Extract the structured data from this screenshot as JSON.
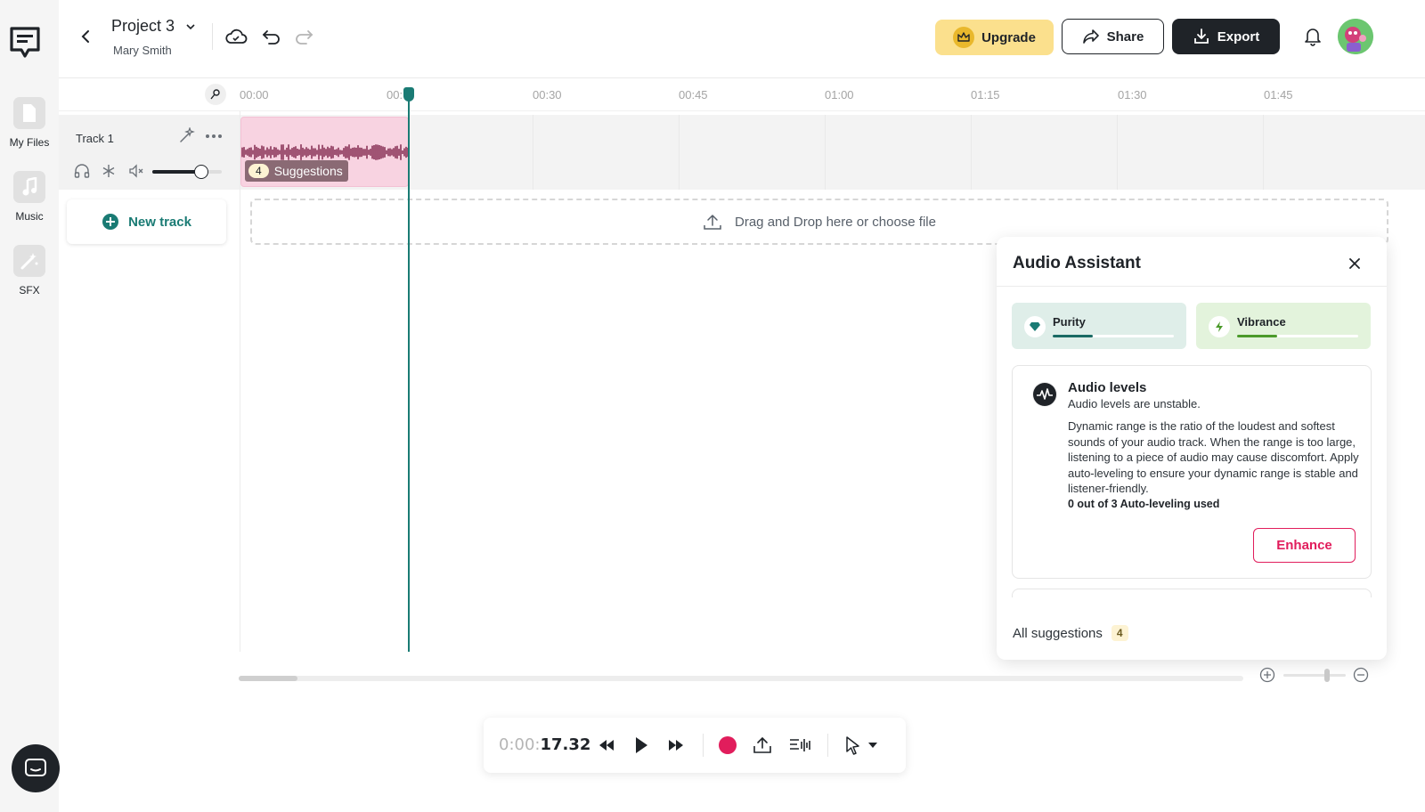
{
  "sidebar": {
    "items": [
      {
        "label": "My Files",
        "icon": "file-icon"
      },
      {
        "label": "Music",
        "icon": "music-note-icon"
      },
      {
        "label": "SFX",
        "icon": "magic-wand-icon"
      }
    ]
  },
  "header": {
    "project_name": "Project 3",
    "owner": "Mary Smith",
    "upgrade_label": "Upgrade",
    "share_label": "Share",
    "export_label": "Export"
  },
  "timeline": {
    "ticks": [
      "00:00",
      "00:",
      "00:30",
      "00:45",
      "01:00",
      "01:15",
      "01:30",
      "01:45"
    ]
  },
  "track": {
    "name": "Track 1",
    "volume": 0.7,
    "clip": {
      "suggestions_count": "4",
      "suggestions_label": "Suggestions"
    }
  },
  "new_track_label": "New track",
  "dropzone_label": "Drag and Drop here or choose file",
  "assistant": {
    "title": "Audio Assistant",
    "metrics": [
      {
        "label": "Purity",
        "level": 0.33,
        "bg": "#dfeee9",
        "fill": "#1a6a64"
      },
      {
        "label": "Vibrance",
        "level": 0.33,
        "bg": "#e3f3dc",
        "fill": "#4b9a2a"
      }
    ],
    "card": {
      "title": "Audio levels",
      "subtitle": "Audio levels are unstable.",
      "body": "Dynamic range is the ratio of the loudest and softest sounds of your audio track. When the range is too large, listening to a piece of audio may cause discomfort. Apply auto-leveling to ensure your dynamic range is stable and listener-friendly.",
      "usage": "0 out of 3 Auto-leveling used",
      "action_label": "Enhance"
    },
    "all_suggestions_label": "All suggestions",
    "all_suggestions_count": "4"
  },
  "transport": {
    "time_dim": "0:00:",
    "time_bold": "17.32"
  },
  "colors": {
    "accent": "#1a7b74",
    "upgrade_bg": "#fbe08d",
    "export_bg": "#1f2328",
    "record": "#e11d5c",
    "clip": "#f8d3e1",
    "waveform": "#7a1d44"
  }
}
